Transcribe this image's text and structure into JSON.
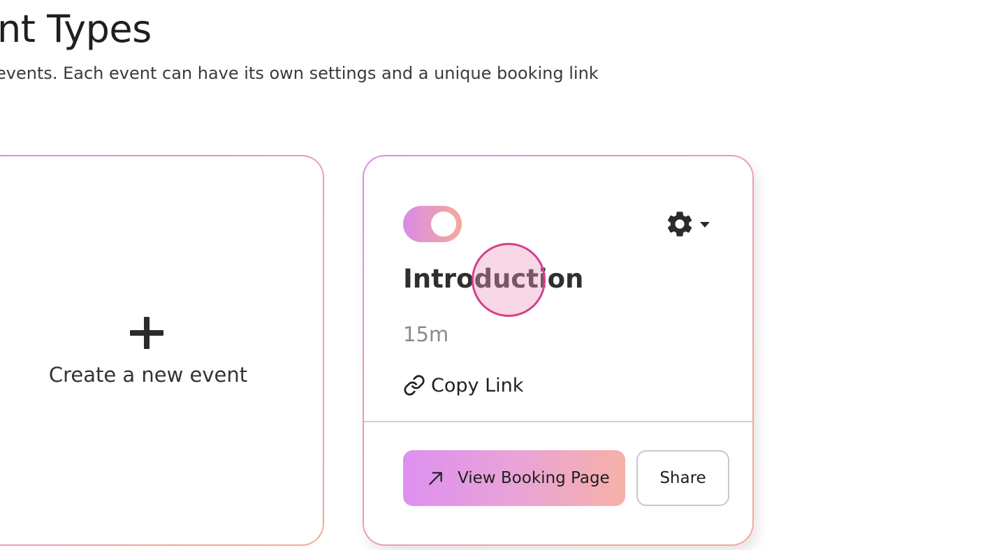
{
  "header": {
    "title": "nt Types",
    "subtitle": "events. Each event can have its own settings and a unique booking link"
  },
  "create_card": {
    "icon": "plus-icon",
    "label": "Create a new event"
  },
  "event_card": {
    "enabled": true,
    "settings_icon": "gear-icon",
    "dropdown_icon": "caret-down-icon",
    "title": "Introduction",
    "duration": "15m",
    "copy_link": {
      "icon": "link-icon",
      "label": "Copy Link"
    },
    "view_booking": {
      "icon": "arrow-up-right-icon",
      "label": "View Booking Page"
    },
    "share_label": "Share"
  },
  "colors": {
    "gradient_start": "#d98be8",
    "gradient_end": "#f4a99a",
    "click_indicator": "#d4408a",
    "text_primary": "#2b2b2b",
    "text_muted": "#8a8a8a"
  }
}
